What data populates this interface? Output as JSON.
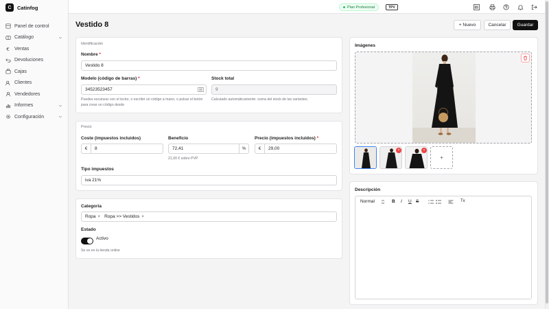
{
  "brand": {
    "logo_letter": "C",
    "name": "Catinfog"
  },
  "sidebar": {
    "items": [
      {
        "label": "Panel de control",
        "icon": "home-icon",
        "chevron": false
      },
      {
        "label": "Catálogo",
        "icon": "box-icon",
        "chevron": true
      },
      {
        "label": "Ventas",
        "icon": "euro-icon",
        "chevron": false
      },
      {
        "label": "Devoluciones",
        "icon": "return-icon",
        "chevron": false
      },
      {
        "label": "Cajas",
        "icon": "cash-register-icon",
        "chevron": false
      },
      {
        "label": "Clientes",
        "icon": "users-icon",
        "chevron": false
      },
      {
        "label": "Vendedores",
        "icon": "user-icon",
        "chevron": false
      },
      {
        "label": "Informes",
        "icon": "chart-icon",
        "chevron": true
      },
      {
        "label": "Configuración",
        "icon": "gear-icon",
        "chevron": true
      }
    ]
  },
  "topbar": {
    "plan": "Plan Profesional",
    "tpv": "TPV"
  },
  "page": {
    "title": "Vestido 8"
  },
  "actions": {
    "new": "+ Nuevo",
    "cancel": "Cancelar",
    "save": "Guardar"
  },
  "identification": {
    "section": "Identificación",
    "name_label": "Nombre",
    "name_value": "Vestido 8",
    "model_label": "Modelo (código de barras)",
    "model_value": "34523523457",
    "model_help": "Puedes escanear con el lector, o escribir un código a mano, o pulsar el botón para crear un código desde",
    "stock_label": "Stock total",
    "stock_value": "9",
    "stock_help": "Calculado automáticamente: suma del stock de las variantes."
  },
  "price": {
    "section": "Precio",
    "cost_label": "Coste (impuestos incluidos)",
    "cost_currency": "€",
    "cost_value": "8",
    "profit_label": "Beneficio",
    "profit_value": "72,41",
    "profit_unit": "%",
    "profit_help": "21,00 € sobre PVP",
    "price_label": "Precio (impuestos incluidos)",
    "price_currency": "€",
    "price_value": "29,00",
    "tax_label": "Tipo impuestos",
    "tax_value": "iva 21%"
  },
  "category": {
    "label": "Categoría",
    "chips": [
      "Ropa",
      "Ropa >> Vestidos"
    ],
    "state_label": "Estado",
    "state_value": "Activo",
    "state_help": "Se ve en la tienda online"
  },
  "images": {
    "title": "Imágenes",
    "add": "+",
    "badge": "×"
  },
  "description": {
    "title": "Descripción",
    "format": "Normal",
    "bold": "B",
    "italic": "I",
    "underline": "U",
    "strike": "S",
    "clear": "Tx"
  },
  "colors": {
    "accent": "#111111",
    "plan_green": "#15803d",
    "danger": "#dc2626"
  }
}
